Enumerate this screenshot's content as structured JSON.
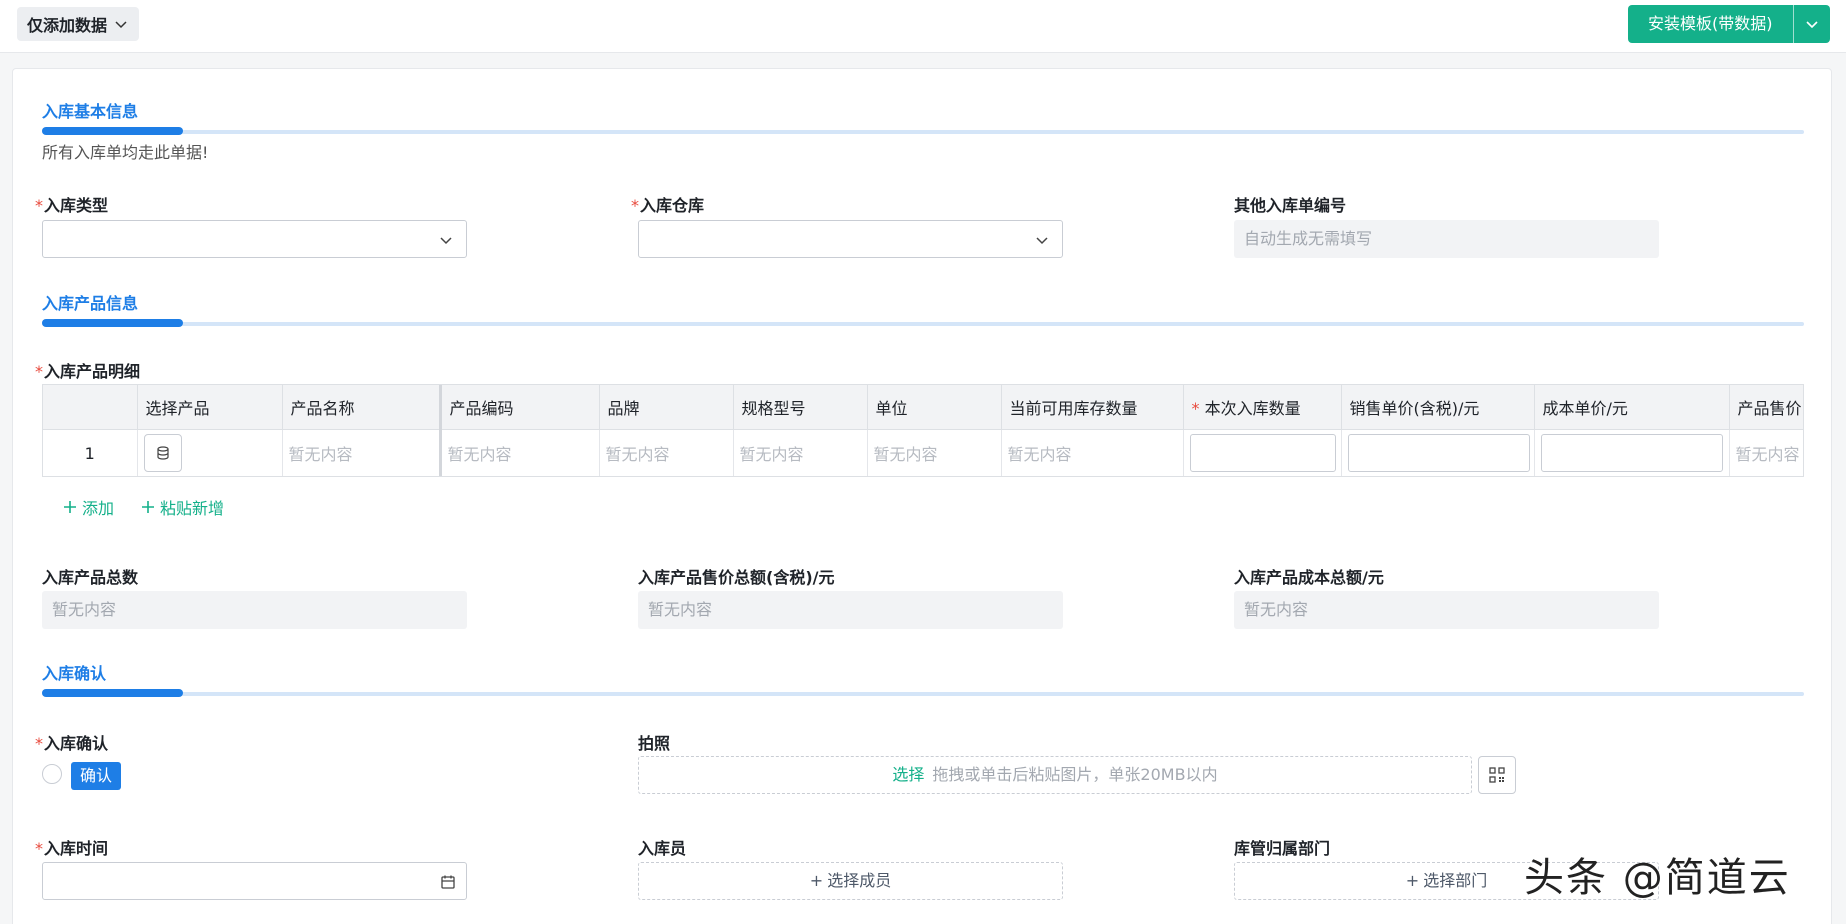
{
  "topbar": {
    "mode_label": "仅添加数据",
    "install_label": "安装模板(带数据)"
  },
  "section_basic": {
    "title": "入库基本信息",
    "desc": "所有入库单均走此单据!",
    "fields": {
      "type_label": "入库类型",
      "warehouse_label": "入库仓库",
      "order_no_label": "其他入库单编号",
      "order_no_placeholder": "自动生成无需填写"
    }
  },
  "section_product": {
    "title": "入库产品信息",
    "detail_label": "入库产品明细",
    "columns": [
      "选择产品",
      "产品名称",
      "产品编码",
      "品牌",
      "规格型号",
      "单位",
      "当前可用库存数量",
      "本次入库数量",
      "销售单价(含税)/元",
      "成本单价/元",
      "产品售价"
    ],
    "row": {
      "index": "1",
      "empty": "暂无内容"
    },
    "add_label": "添加",
    "paste_label": "粘贴新增",
    "total_count_label": "入库产品总数",
    "total_sale_label": "入库产品售价总额(含税)/元",
    "total_cost_label": "入库产品成本总额/元",
    "empty": "暂无内容"
  },
  "section_confirm": {
    "title": "入库确认",
    "confirm_label": "入库确认",
    "confirm_option": "确认",
    "photo_label": "拍照",
    "upload_choose": "选择",
    "upload_hint": "拖拽或单击后粘贴图片，单张20MB以内",
    "time_label": "入库时间",
    "operator_label": "入库员",
    "operator_placeholder": "选择成员",
    "dept_label": "库管归属部门",
    "dept_placeholder": "选择部门"
  },
  "watermark": "头条 @简道云",
  "colors": {
    "accent_blue": "#1e7ee6",
    "accent_green": "#14b08a",
    "required": "#e84a3d"
  }
}
